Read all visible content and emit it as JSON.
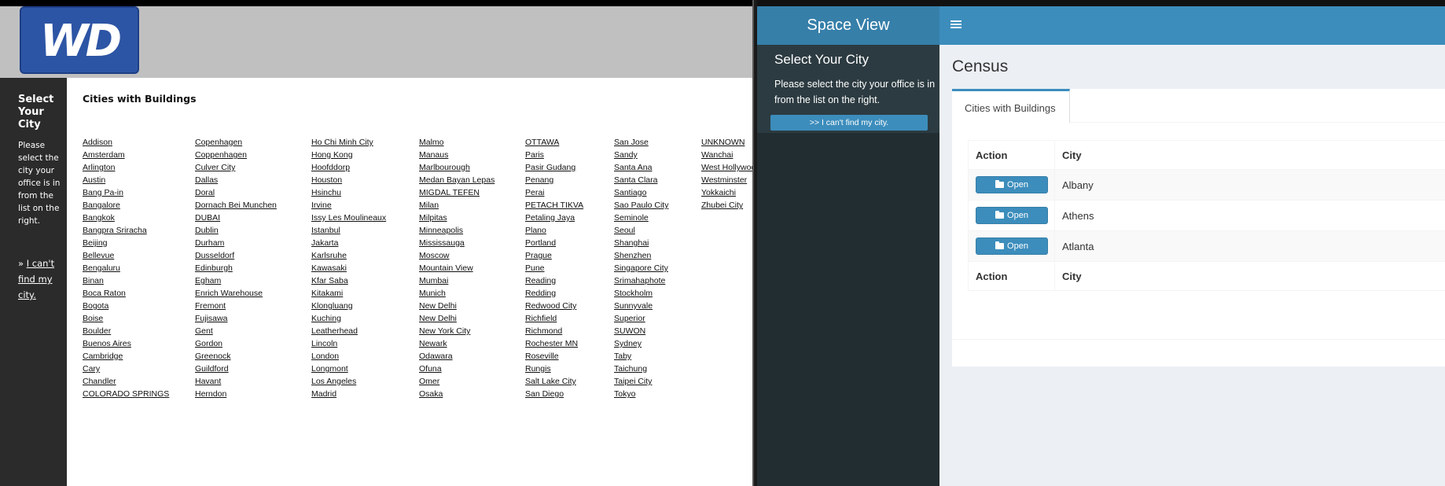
{
  "left": {
    "logo_text": "WD",
    "sidebar": {
      "title": "Select Your City",
      "description": "Please select the city your office is in from the list on the right.",
      "link_prefix": "» ",
      "link_text": "I can't find my city."
    },
    "content_title": "Cities with Buildings",
    "columns": [
      [
        "Addison",
        "Amsterdam",
        "Arlington",
        "Austin",
        "Bang Pa-in",
        "Bangalore",
        "Bangkok",
        "Bangpra Sriracha",
        "Beijing",
        "Bellevue",
        "Bengaluru",
        "Binan",
        "Boca Raton",
        "Bogota",
        "Boise",
        "Boulder",
        "Buenos Aires",
        "Cambridge",
        "Cary",
        "Chandler",
        "COLORADO SPRINGS"
      ],
      [
        "Copenhagen",
        "Coppenhagen",
        "Culver City",
        "Dallas",
        "Doral",
        "Dornach Bei Munchen",
        "DUBAI",
        "Dublin",
        "Durham",
        "Dusseldorf",
        "Edinburgh",
        "Egham",
        "Enrich Warehouse",
        "Fremont",
        "Fujisawa",
        "Gent",
        "Gordon",
        "Greenock",
        "Guildford",
        "Havant",
        "Herndon"
      ],
      [
        "Ho Chi Minh City",
        "Hong Kong",
        "Hoofddorp",
        "Houston",
        "Hsinchu",
        "Irvine",
        "Issy Les Moulineaux",
        "Istanbul",
        "Jakarta",
        "Karlsruhe",
        "Kawasaki",
        "Kfar Saba",
        "Kitakami",
        "Klongluang",
        "Kuching",
        "Leatherhead",
        "Lincoln",
        "London",
        "Longmont",
        "Los Angeles",
        "Madrid"
      ],
      [
        "Malmo",
        "Manaus",
        "Marlbourough",
        "Medan Bayan Lepas",
        "MIGDAL TEFEN",
        "Milan",
        "Milpitas",
        "Minneapolis",
        "Mississauga",
        "Moscow",
        "Mountain View",
        "Mumbai",
        "Munich",
        "New Delhi",
        "New Delhi",
        "New York City",
        "Newark",
        "Odawara",
        "Ofuna",
        "Omer",
        "Osaka"
      ],
      [
        "OTTAWA",
        "Paris",
        "Pasir Gudang",
        "Penang",
        "Perai",
        "PETACH TIKVA",
        "Petaling Jaya",
        "Plano",
        "Portland",
        "Prague",
        "Pune",
        "Reading",
        "Redding",
        "Redwood City",
        "Richfield",
        "Richmond",
        "Rochester MN",
        "Roseville",
        "Rungis",
        "Salt Lake City",
        "San Diego"
      ],
      [
        "San Jose",
        "Sandy",
        "Santa Ana",
        "Santa Clara",
        "Santiago",
        "Sao Paulo City",
        "Seminole",
        "Seoul",
        "Shanghai",
        "Shenzhen",
        "Singapore City",
        "Srimahaphote",
        "Stockholm",
        "Sunnyvale",
        "Superior",
        "SUWON",
        "Sydney",
        "Taby",
        "Taichung",
        "Taipei City",
        "Tokyo"
      ],
      [
        "UNKNOWN",
        "Wanchai",
        "West Hollywood",
        "Westminster",
        "Yokkaichi",
        "Zhubei City"
      ]
    ]
  },
  "right": {
    "brand": "Space View",
    "menu_icon": "hamburger-icon",
    "sidebar": {
      "title": "Select Your City",
      "description": "Please select the city your office is in from the list on the right.",
      "button_label": ">> I can't find my city."
    },
    "page_title": "Census",
    "tab_label": "Cities with Buildings",
    "table": {
      "headers": [
        "Action",
        "City"
      ],
      "rows": [
        {
          "button": "Open",
          "city": "Albany"
        },
        {
          "button": "Open",
          "city": "Athens"
        },
        {
          "button": "Open",
          "city": "Atlanta"
        }
      ],
      "footer": [
        "Action",
        "City"
      ]
    },
    "colors": {
      "navbar": "#3c8dbc",
      "brand_bg": "#367fa9",
      "sidebar_bg": "#222d32",
      "content_bg": "#ecf0f5"
    }
  }
}
